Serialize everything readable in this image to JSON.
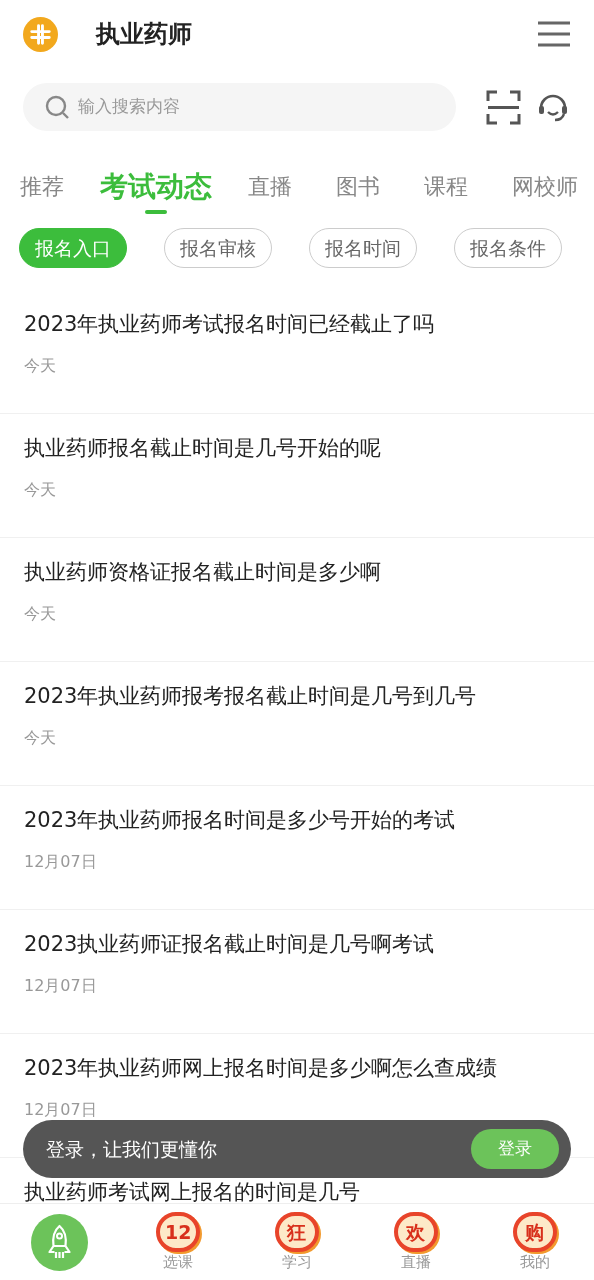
{
  "header": {
    "title": "执业药师"
  },
  "search": {
    "placeholder": "输入搜索内容"
  },
  "tabs": [
    {
      "label": "推荐",
      "selected": false
    },
    {
      "label": "考试动态",
      "selected": true
    },
    {
      "label": "直播",
      "selected": false
    },
    {
      "label": "图书",
      "selected": false
    },
    {
      "label": "课程",
      "selected": false
    },
    {
      "label": "网校师",
      "selected": false
    }
  ],
  "chips": [
    {
      "label": "报名入口",
      "selected": true
    },
    {
      "label": "报名审核",
      "selected": false
    },
    {
      "label": "报名时间",
      "selected": false
    },
    {
      "label": "报名条件",
      "selected": false
    }
  ],
  "articles": [
    {
      "title": "2023年执业药师考试报名时间已经截止了吗",
      "date": "今天"
    },
    {
      "title": "执业药师报名截止时间是几号开始的呢",
      "date": "今天"
    },
    {
      "title": "执业药师资格证报名截止时间是多少啊",
      "date": "今天"
    },
    {
      "title": "2023年执业药师报考报名截止时间是几号到几号",
      "date": "今天"
    },
    {
      "title": "2023年执业药师报名时间是多少号开始的考试",
      "date": "12月07日"
    },
    {
      "title": "2023执业药师证报名截止时间是几号啊考试",
      "date": "12月07日"
    },
    {
      "title": "2023年执业药师网上报名时间是多少啊怎么查成绩",
      "date": "12月07日"
    },
    {
      "title": "执业药师考试网上报名的时间是几号"
    }
  ],
  "login_banner": {
    "text": "登录，让我们更懂你",
    "button": "登录"
  },
  "bottom_nav": [
    {
      "kind": "rocket"
    },
    {
      "kind": "badge",
      "badge": "12",
      "label": "选课"
    },
    {
      "kind": "badge",
      "badge": "狂",
      "label": "学习"
    },
    {
      "kind": "badge",
      "badge": "欢",
      "label": "直播"
    },
    {
      "kind": "badge",
      "badge": "购",
      "label": "我的"
    }
  ]
}
